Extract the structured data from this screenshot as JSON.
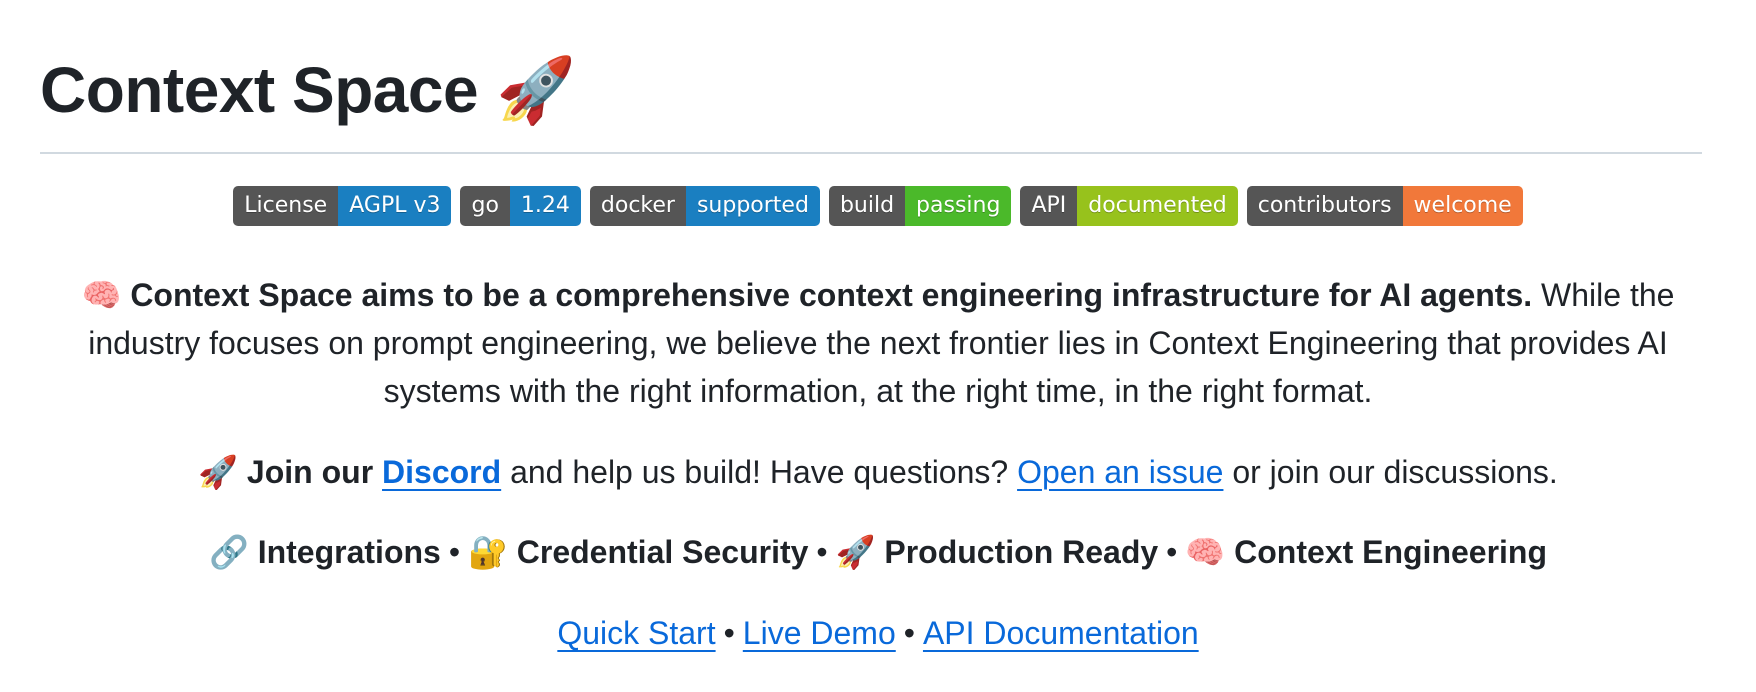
{
  "header": {
    "title": "Context Space",
    "title_emoji": "🚀"
  },
  "badges": [
    {
      "label": "License",
      "value": "AGPL v3",
      "color": "#1a7fc1"
    },
    {
      "label": "go",
      "value": "1.24",
      "color": "#1a7fc1"
    },
    {
      "label": "docker",
      "value": "supported",
      "color": "#1a7fc1"
    },
    {
      "label": "build",
      "value": "passing",
      "color": "#4bb92a"
    },
    {
      "label": "API",
      "value": "documented",
      "color": "#97c21c"
    },
    {
      "label": "contributors",
      "value": "welcome",
      "color": "#f1783a"
    }
  ],
  "intro": {
    "emoji": "🧠",
    "bold": "Context Space aims to be a comprehensive context engineering infrastructure for AI agents.",
    "text": " While the industry focuses on prompt engineering, we believe the next frontier lies in Context Engineering that provides AI systems with the right information, at the right time, in the right format."
  },
  "join": {
    "emoji": "🚀",
    "bold": "Join our",
    "discord_link": "Discord",
    "middle": " and help us build! Have questions? ",
    "issue_link": "Open an issue",
    "end": " or join our discussions."
  },
  "features": [
    {
      "emoji": "🔗",
      "label": "Integrations"
    },
    {
      "emoji": "🔐",
      "label": "Credential Security"
    },
    {
      "emoji": "🚀",
      "label": "Production Ready"
    },
    {
      "emoji": "🧠",
      "label": "Context Engineering"
    }
  ],
  "separator": "•",
  "links": [
    {
      "label": "Quick Start"
    },
    {
      "label": "Live Demo"
    },
    {
      "label": "API Documentation"
    }
  ],
  "colors": {
    "text": "#1f2328",
    "link": "#0969da",
    "divider": "#d1d9e0",
    "badge_left": "#555555"
  }
}
